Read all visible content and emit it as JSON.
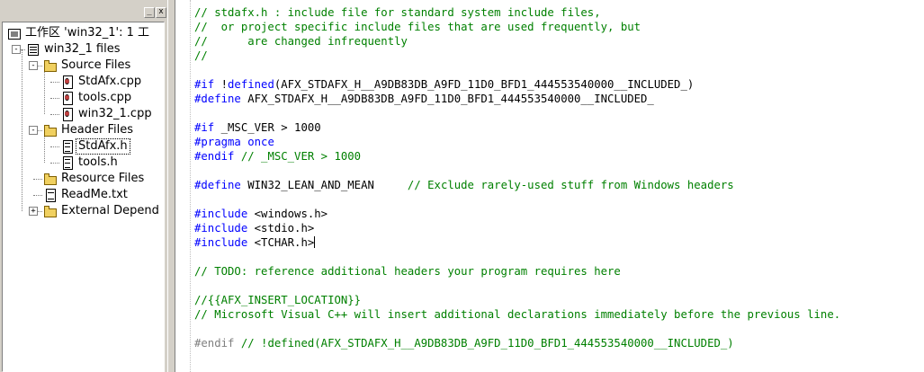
{
  "workspace": {
    "min_btn": "_",
    "close_btn": "x",
    "tree": [
      {
        "name": "workspace-root",
        "label": "工作区 'win32_1': 1 工",
        "icon": "workspace-icon",
        "level": 0,
        "expand": null
      },
      {
        "name": "project-win32-1",
        "label": "win32_1 files",
        "icon": "project-icon",
        "level": 1,
        "expand": "-"
      },
      {
        "name": "folder-source-files",
        "label": "Source Files",
        "icon": "folder-icon",
        "level": 2,
        "expand": "-"
      },
      {
        "name": "file-stdafx-cpp",
        "label": "StdAfx.cpp",
        "icon": "cpp-file-icon",
        "level": 3,
        "expand": null
      },
      {
        "name": "file-tools-cpp",
        "label": "tools.cpp",
        "icon": "cpp-file-icon",
        "level": 3,
        "expand": null
      },
      {
        "name": "file-win32-1-cpp",
        "label": "win32_1.cpp",
        "icon": "cpp-file-icon",
        "level": 3,
        "expand": null
      },
      {
        "name": "folder-header-files",
        "label": "Header Files",
        "icon": "folder-icon",
        "level": 2,
        "expand": "-"
      },
      {
        "name": "file-stdafx-h",
        "label": "StdAfx.h",
        "icon": "header-file-icon",
        "level": 3,
        "expand": null,
        "selected": true
      },
      {
        "name": "file-tools-h",
        "label": "tools.h",
        "icon": "header-file-icon",
        "level": 3,
        "expand": null
      },
      {
        "name": "folder-resource-files",
        "label": "Resource Files",
        "icon": "folder-icon",
        "level": 2,
        "expand": null
      },
      {
        "name": "file-readme-txt",
        "label": "ReadMe.txt",
        "icon": "text-file-icon",
        "level": 2,
        "expand": null
      },
      {
        "name": "folder-external-dependencies",
        "label": "External Depend",
        "icon": "folder-icon",
        "level": 2,
        "expand": "+"
      }
    ]
  },
  "colors": {
    "comment": "#008000",
    "keyword": "#0000ff",
    "text": "#000000",
    "inactive": "#808080"
  },
  "editor": {
    "lines": [
      [
        {
          "t": "comment",
          "s": "// stdafx.h : include file for standard system include files,"
        }
      ],
      [
        {
          "t": "comment",
          "s": "//  or project specific include files that are used frequently, but"
        }
      ],
      [
        {
          "t": "comment",
          "s": "//      are changed infrequently"
        }
      ],
      [
        {
          "t": "comment",
          "s": "//"
        }
      ],
      [],
      [
        {
          "t": "keyword",
          "s": "#if"
        },
        {
          "t": "text",
          "s": " !"
        },
        {
          "t": "keyword",
          "s": "defined"
        },
        {
          "t": "text",
          "s": "(AFX_STDAFX_H__A9DB83DB_A9FD_11D0_BFD1_444553540000__INCLUDED_)"
        }
      ],
      [
        {
          "t": "keyword",
          "s": "#define"
        },
        {
          "t": "text",
          "s": " AFX_STDAFX_H__A9DB83DB_A9FD_11D0_BFD1_444553540000__INCLUDED_"
        }
      ],
      [],
      [
        {
          "t": "keyword",
          "s": "#if"
        },
        {
          "t": "text",
          "s": " _MSC_VER > 1000"
        }
      ],
      [
        {
          "t": "keyword",
          "s": "#pragma"
        },
        {
          "t": "text",
          "s": " "
        },
        {
          "t": "keyword",
          "s": "once"
        }
      ],
      [
        {
          "t": "keyword",
          "s": "#endif"
        },
        {
          "t": "text",
          "s": " "
        },
        {
          "t": "comment",
          "s": "// _MSC_VER > 1000"
        }
      ],
      [],
      [
        {
          "t": "keyword",
          "s": "#define"
        },
        {
          "t": "text",
          "s": " WIN32_LEAN_AND_MEAN     "
        },
        {
          "t": "comment",
          "s": "// Exclude rarely-used stuff from Windows headers"
        }
      ],
      [],
      [
        {
          "t": "keyword",
          "s": "#include"
        },
        {
          "t": "text",
          "s": " <windows.h>"
        }
      ],
      [
        {
          "t": "keyword",
          "s": "#include"
        },
        {
          "t": "text",
          "s": " <stdio.h>"
        }
      ],
      [
        {
          "t": "keyword",
          "s": "#include"
        },
        {
          "t": "text",
          "s": " <TCHAR.h>"
        },
        {
          "t": "caret",
          "s": ""
        }
      ],
      [],
      [
        {
          "t": "comment",
          "s": "// TODO: reference additional headers your program requires here"
        }
      ],
      [],
      [
        {
          "t": "comment",
          "s": "//{{AFX_INSERT_LOCATION}}"
        }
      ],
      [
        {
          "t": "comment",
          "s": "// Microsoft Visual C++ will insert additional declarations immediately before the previous line."
        }
      ],
      [],
      [
        {
          "t": "grey",
          "s": "#endif"
        },
        {
          "t": "text",
          "s": " "
        },
        {
          "t": "comment",
          "s": "// !defined(AFX_STDAFX_H__A9DB83DB_A9FD_11D0_BFD1_444553540000__INCLUDED_)"
        }
      ]
    ]
  }
}
